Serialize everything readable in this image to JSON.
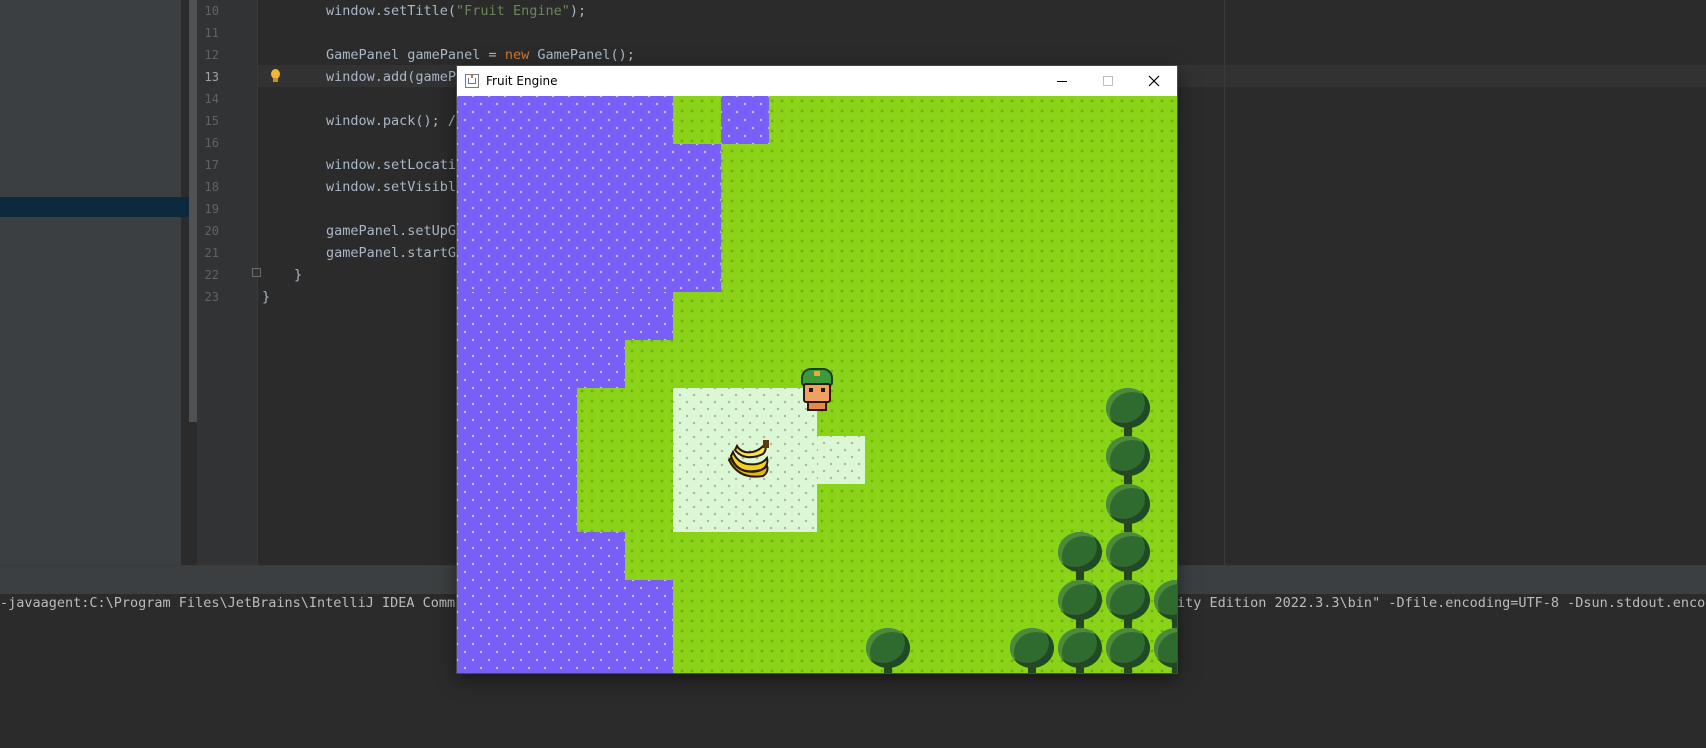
{
  "editor": {
    "lines": [
      {
        "no": "10",
        "active": false,
        "code": [
          {
            "t": "window.setTitle(",
            "c": ""
          },
          {
            "t": "\"Fruit Engine\"",
            "c": "str"
          },
          {
            "t": ");",
            "c": ""
          }
        ]
      },
      {
        "no": "11",
        "active": false,
        "code": []
      },
      {
        "no": "12",
        "active": false,
        "code": [
          {
            "t": "GamePanel gamePanel = ",
            "c": ""
          },
          {
            "t": "new",
            "c": "kw"
          },
          {
            "t": " GamePanel();",
            "c": ""
          }
        ]
      },
      {
        "no": "13",
        "active": true,
        "code": [
          {
            "t": "window.add(gameP",
            "c": ""
          }
        ]
      },
      {
        "no": "14",
        "active": false,
        "code": []
      },
      {
        "no": "15",
        "active": false,
        "code": [
          {
            "t": "window.pack(); /",
            "c": ""
          }
        ]
      },
      {
        "no": "16",
        "active": false,
        "code": []
      },
      {
        "no": "17",
        "active": false,
        "code": [
          {
            "t": "window.setLocati",
            "c": ""
          }
        ]
      },
      {
        "no": "18",
        "active": false,
        "code": [
          {
            "t": "window.setVisibl",
            "c": ""
          }
        ]
      },
      {
        "no": "19",
        "active": false,
        "code": []
      },
      {
        "no": "20",
        "active": false,
        "code": [
          {
            "t": "gamePanel.setUpG",
            "c": ""
          }
        ]
      },
      {
        "no": "21",
        "active": false,
        "code": [
          {
            "t": "gamePanel.startG",
            "c": ""
          }
        ]
      },
      {
        "no": "22",
        "active": false,
        "code": [
          {
            "t": "}",
            "c": ""
          }
        ]
      },
      {
        "no": "23",
        "active": false,
        "code": [
          {
            "t": "}",
            "c": ""
          }
        ]
      }
    ]
  },
  "console": {
    "line_left": "-javaagent:C:\\Program Files\\JetBrains\\IntelliJ IDEA Commun",
    "line_right": "ity Edition 2022.3.3\\bin\" -Dfile.encoding=UTF-8 -Dsun.stdout.encod"
  },
  "window": {
    "title": "Fruit Engine",
    "icon": "java-cup-icon",
    "controls": [
      "minimize-icon",
      "maximize-icon",
      "close-icon"
    ]
  },
  "game": {
    "sprites": [
      "player-character",
      "banana-fruit",
      "tree"
    ],
    "colors": {
      "grass": "#8bd319",
      "water": "#7a5ff7",
      "sand": "#dcf7d4",
      "tree": "#2f6a2f"
    }
  }
}
